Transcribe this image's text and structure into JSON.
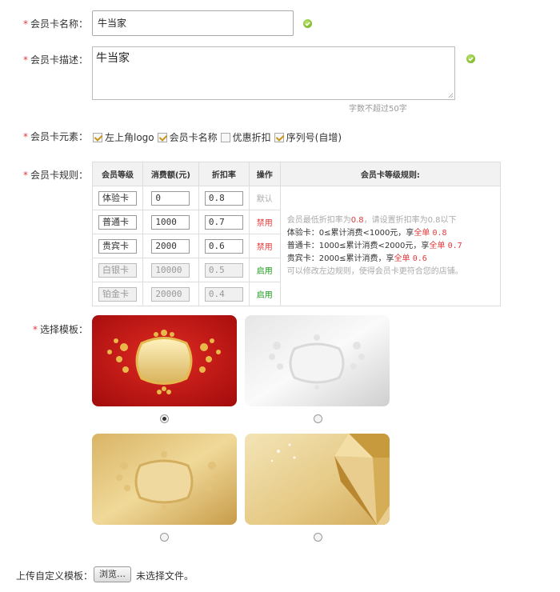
{
  "form": {
    "name": {
      "required": "*",
      "label": "会员卡名称：",
      "value": "牛当家"
    },
    "desc": {
      "required": "*",
      "label": "会员卡描述：",
      "value": "牛当家",
      "hint": "字数不超过50字"
    },
    "elements": {
      "required": "*",
      "label": "会员卡元素：",
      "options": [
        {
          "label": "左上角logo",
          "checked": true
        },
        {
          "label": "会员卡名称",
          "checked": true
        },
        {
          "label": "优惠折扣",
          "checked": false
        },
        {
          "label": "序列号(自增)",
          "checked": true
        }
      ]
    },
    "rules": {
      "required": "*",
      "label": "会员卡规则：",
      "headers": [
        "会员等级",
        "消费额(元)",
        "折扣率",
        "操作",
        "会员卡等级规则:"
      ],
      "rows": [
        {
          "level": "体验卡",
          "amount": "0",
          "rate": "0.8",
          "op": "默认"
        },
        {
          "level": "普通卡",
          "amount": "1000",
          "rate": "0.7",
          "op": "禁用"
        },
        {
          "level": "贵宾卡",
          "amount": "2000",
          "rate": "0.6",
          "op": "禁用"
        },
        {
          "level": "白银卡",
          "amount": "10000",
          "rate": "0.5",
          "op": "启用"
        },
        {
          "level": "铂金卡",
          "amount": "20000",
          "rate": "0.4",
          "op": "启用"
        }
      ],
      "notes": {
        "line1_pre": "会员最低折扣率为",
        "line1_val": "0.8",
        "line1_post": "，请设置折扣率为0.8以下",
        "line2_pre": "体验卡：0≤累计消费<1000元，享",
        "line2_red": "全单",
        "line2_val": "0.8",
        "line3_pre": "普通卡：1000≤累计消费<2000元，享",
        "line3_red": "全单",
        "line3_val": "0.7",
        "line4_pre": "贵宾卡：2000≤累计消费，享",
        "line4_red": "全单",
        "line4_val": "0.6",
        "line5": "可以修改左边规则，使得会员卡更符合您的店铺。"
      }
    },
    "template": {
      "required": "*",
      "label": "选择模板：",
      "selected_index": 0
    },
    "upload": {
      "label": "上传自定义模板：",
      "button": "浏览…",
      "status": "未选择文件。"
    }
  },
  "colors": {
    "required": "#e4393c",
    "enable": "#1a9b1a",
    "disable": "#e4393c",
    "ok": "#69a80f"
  },
  "icons": {
    "valid": "check-circle-icon"
  }
}
